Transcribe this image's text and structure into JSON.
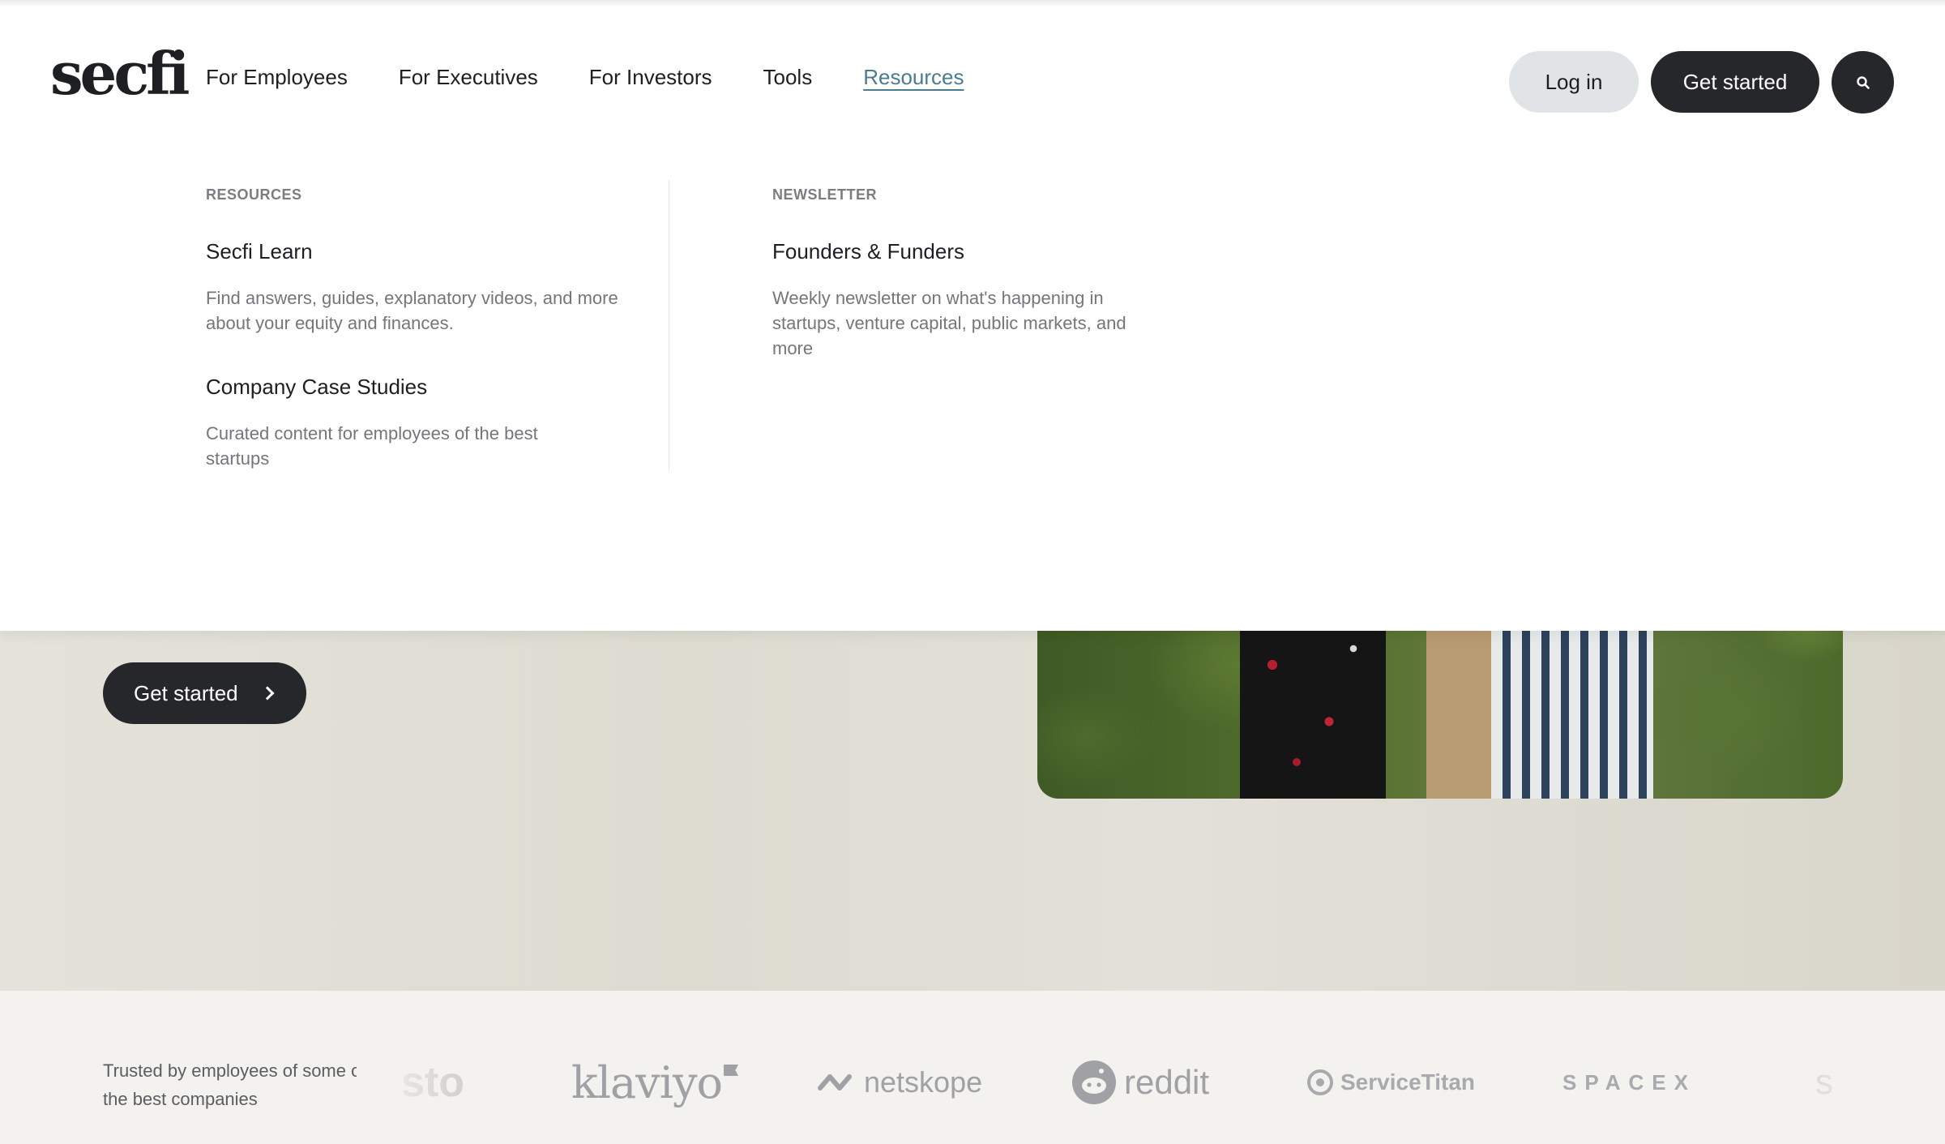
{
  "header": {
    "logo": "secfi",
    "nav": [
      {
        "label": "For Employees"
      },
      {
        "label": "For Executives"
      },
      {
        "label": "For Investors"
      },
      {
        "label": "Tools"
      },
      {
        "label": "Resources",
        "active": true
      }
    ],
    "login_label": "Log in",
    "get_started_label": "Get started"
  },
  "dropdown": {
    "resources": {
      "heading": "RESOURCES",
      "items": [
        {
          "title": "Secfi Learn",
          "description": "Find answers, guides, explanatory videos, and more about your equity and finances."
        },
        {
          "title": "Company Case Studies",
          "description": "Curated content for employees of the best startups"
        }
      ]
    },
    "newsletter": {
      "heading": "NEWSLETTER",
      "items": [
        {
          "title": "Founders & Funders",
          "description": "Weekly newsletter on what's happening in startups, venture capital, public markets, and more"
        }
      ]
    }
  },
  "hero": {
    "cta_label": "Get started"
  },
  "trusted": {
    "text": "Trusted by employees of some of the best companies",
    "logos": [
      "sto",
      "klaviyo",
      "netskope",
      "reddit",
      "ServiceTitan",
      "SPACEX",
      "s"
    ]
  },
  "colors": {
    "dark": "#25272b",
    "accent_link": "#4a7c8f",
    "login_bg": "#e1e4e6"
  }
}
